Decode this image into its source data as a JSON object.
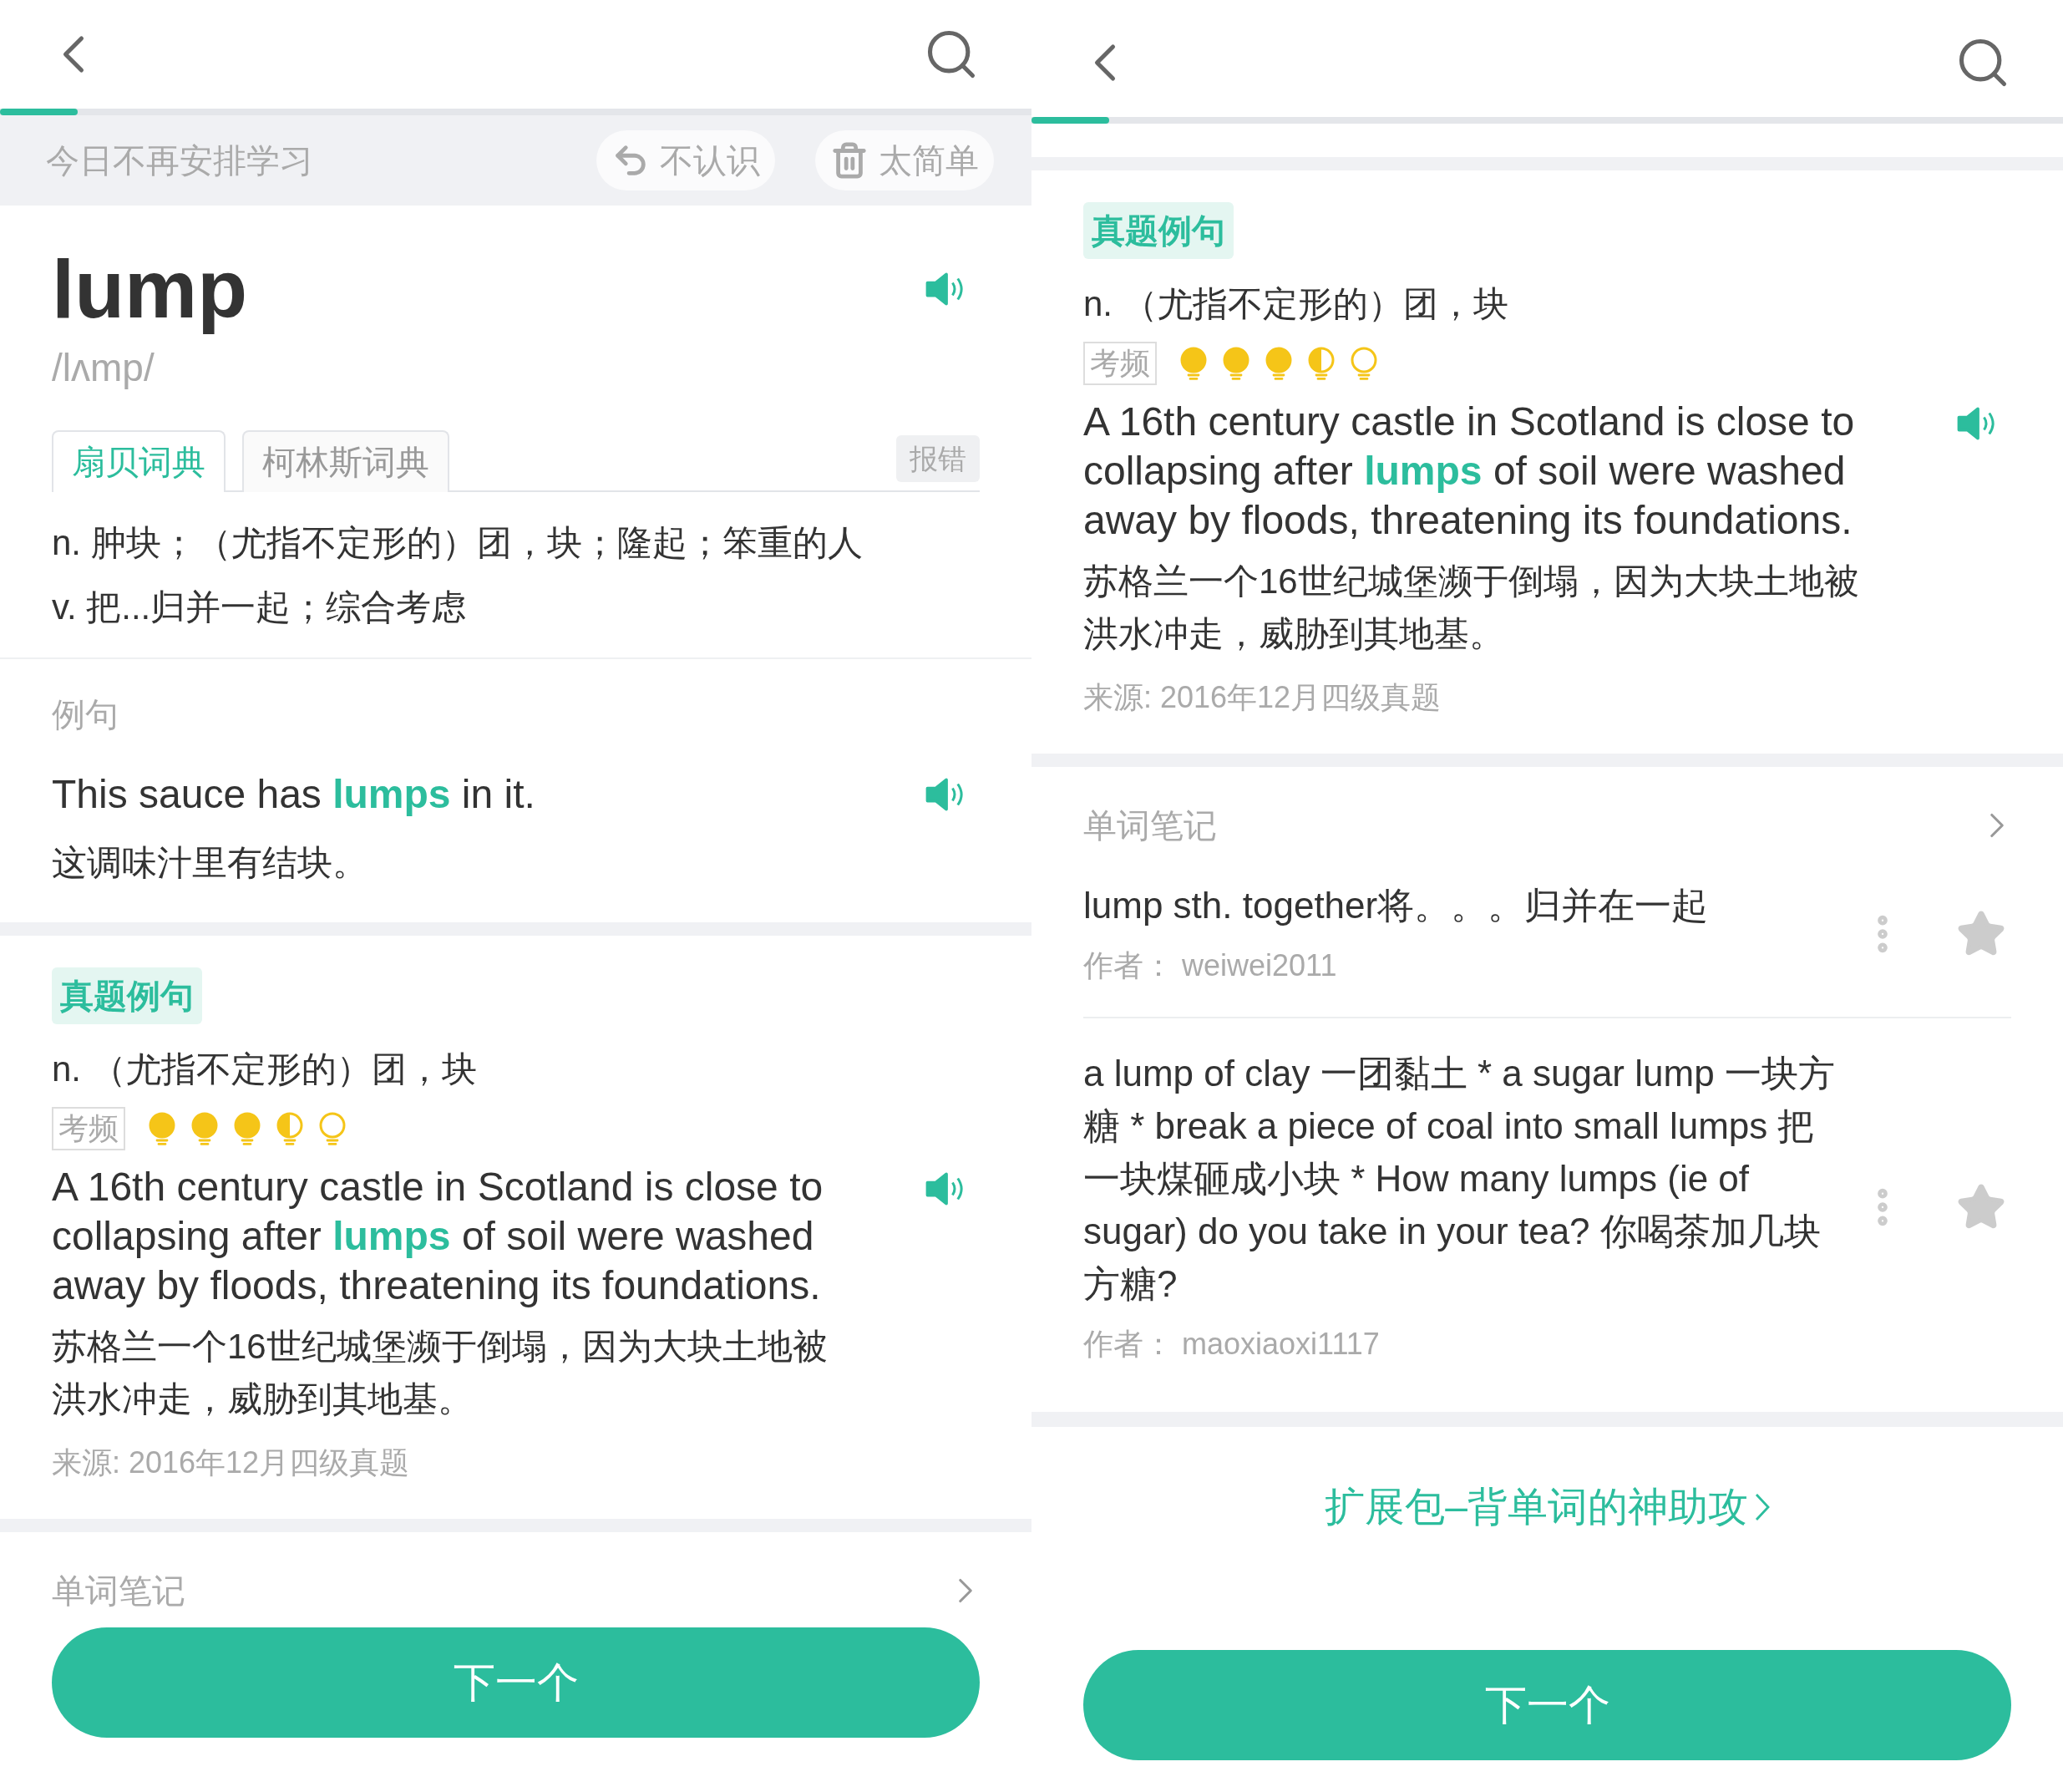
{
  "left": {
    "progress": {
      "level": 0.075
    },
    "action_bar": {
      "skip_today": "今日不再安排学习",
      "buttons": [
        {
          "label": "不认识",
          "kind": "undo"
        },
        {
          "label": "太简单",
          "kind": "trash"
        }
      ]
    },
    "word": {
      "headword": "lump",
      "phonetic": "/lʌmp/"
    },
    "dictionary_tabs": [
      {
        "label": "扇贝词典",
        "selected": true
      },
      {
        "label": "柯林斯词典",
        "selected": false
      }
    ],
    "report_button": "报错",
    "definitions": [
      "n. 肿块；（尤指不定形的）团，块；隆起；笨重的人",
      "v. 把...归并一起；综合考虑"
    ],
    "example": {
      "label": "例句",
      "sentence": "This sauce has **lumps** in it.",
      "translation": "这调味汁里有结块。"
    },
    "exam_example": {
      "badge": "真题例句",
      "definition": "n. （尤指不定形的）团，块",
      "frequency_label": "考频",
      "stars": 3.5,
      "sentence": "A 16th century castle in Scotland is close to collapsing after **lumps** of soil were washed away by floods, threatening its foundations.",
      "translation": "苏格兰一个16世纪城堡濒于倒塌，因为大块土地被洪水冲走，威胁到其地基。",
      "source": "来源: 2016年12月四级真题"
    },
    "notes_header": "单词笔记",
    "next_button": "下一个"
  },
  "right": {
    "progress": {
      "level": 0.075
    },
    "exam_example": {
      "badge": "真题例句",
      "definition": "n. （尤指不定形的）团，块",
      "frequency_label": "考频",
      "stars": 3.5,
      "sentence": "A 16th century castle in Scotland is close to collapsing after **lumps** of soil were washed away by floods, threatening its foundations.",
      "translation": "苏格兰一个16世纪城堡濒于倒塌，因为大块土地被洪水冲走，威胁到其地基。",
      "source": "来源: 2016年12月四级真题"
    },
    "notes_header": "单词笔记",
    "notes": [
      {
        "text": "lump sth. together将。。。归并在一起",
        "author": "作者： weiwei2011"
      },
      {
        "text": "a lump of clay 一团黏土 * a sugar lump 一块方糖 * break a piece of coal into small lumps 把一块煤砸成小块 * How many lumps (ie of sugar) do you take in your tea? 你喝茶加几块方糖?",
        "author": "作者： maoxiaoxi1117"
      }
    ],
    "link": "扩展包–背单词的神助攻",
    "next_button": "下一个"
  }
}
